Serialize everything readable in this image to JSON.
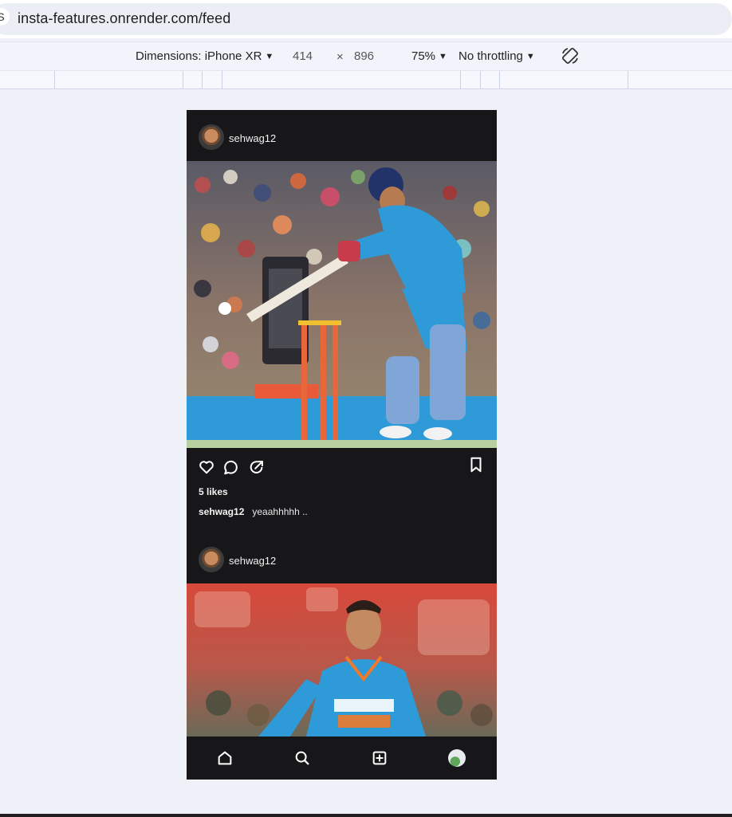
{
  "browser": {
    "url": "insta-features.onrender.com/feed"
  },
  "device_toolbar": {
    "dimensions_label": "Dimensions: iPhone XR",
    "width": "414",
    "times": "×",
    "height": "896",
    "zoom": "75%",
    "throttling": "No throttling"
  },
  "feed": {
    "posts": [
      {
        "username": "sehwag12",
        "likes": "5 likes",
        "caption_user": "sehwag12",
        "caption_text": "yeaahhhhh .."
      },
      {
        "username": "sehwag12"
      }
    ]
  },
  "colors": {
    "phone_bg": "#17171a",
    "page_bg": "#eef1f8",
    "jersey_blue": "#2f9ad8"
  },
  "icons": {
    "post_actions": [
      "heart-icon",
      "comment-icon",
      "share-icon",
      "bookmark-icon"
    ],
    "nav": [
      "home-icon",
      "search-icon",
      "add-post-icon",
      "profile-avatar"
    ]
  }
}
